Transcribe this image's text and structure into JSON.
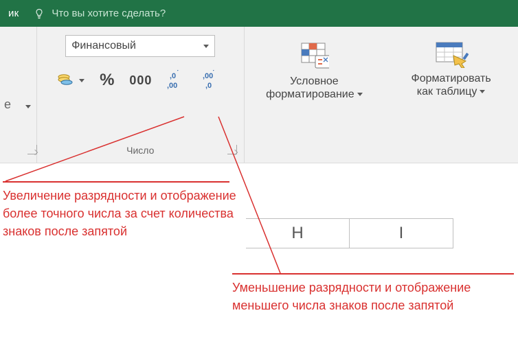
{
  "titlebar": {
    "fragment": "ик",
    "search_placeholder": "Что вы хотите сделать?"
  },
  "prev": {
    "fragment": "е"
  },
  "number_group": {
    "format_value": "Финансовый",
    "label": "Число",
    "percent": "%",
    "comma": "000",
    "inc": ",0\n,00",
    "dec": ",00\n,0"
  },
  "cond": {
    "line1": "Условное",
    "line2": "форматирование"
  },
  "tbl": {
    "line1": "Форматировать",
    "line2": "как таблицу"
  },
  "columns": {
    "H": "H",
    "I": "I"
  },
  "annotations": {
    "increase": "Увеличение разрядности и отображение более точного числа за счет количества знаков после запятой",
    "decrease": "Уменьшение разрядности и отображение меньшего числа знаков после запятой"
  }
}
